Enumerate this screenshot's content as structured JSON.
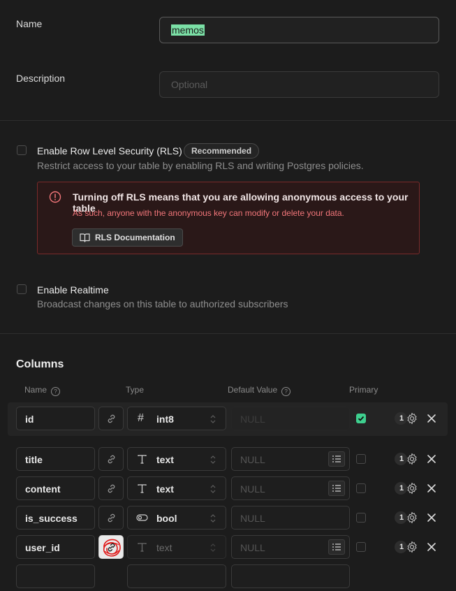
{
  "name_field": {
    "label": "Name",
    "value": "memos"
  },
  "description_field": {
    "label": "Description",
    "placeholder": "Optional"
  },
  "rls": {
    "title": "Enable Row Level Security (RLS)",
    "badge": "Recommended",
    "description": "Restrict access to your table by enabling RLS and writing Postgres policies.",
    "alert_title": "Turning off RLS means that you are allowing anonymous access to your table",
    "alert_desc": "As such, anyone with the anonymous key can modify or delete your data.",
    "doc_button": "RLS Documentation"
  },
  "realtime": {
    "title": "Enable Realtime",
    "description": "Broadcast changes on this table to authorized subscribers"
  },
  "columns": {
    "heading": "Columns",
    "headers": {
      "name": "Name",
      "type": "Type",
      "default": "Default Value",
      "primary": "Primary"
    },
    "rows": [
      {
        "name": "id",
        "type": "int8",
        "type_icon": "hash-icon",
        "default": "NULL",
        "primary": true,
        "count": "1"
      },
      {
        "name": "title",
        "type": "text",
        "type_icon": "text-type-icon",
        "default": "NULL",
        "primary": false,
        "count": "1"
      },
      {
        "name": "content",
        "type": "text",
        "type_icon": "text-type-icon",
        "default": "NULL",
        "primary": false,
        "count": "1"
      },
      {
        "name": "is_success",
        "type": "bool",
        "type_icon": "toggle-icon",
        "default": "NULL",
        "primary": false,
        "count": "1"
      },
      {
        "name": "user_id",
        "type": "text",
        "type_icon": "text-type-icon",
        "default": "NULL",
        "primary": false,
        "count": "1"
      }
    ]
  },
  "colors": {
    "accent": "#3ecf8e",
    "danger": "#f2767a",
    "highlight": "#7be0a6"
  }
}
